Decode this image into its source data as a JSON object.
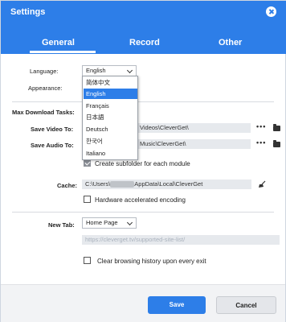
{
  "window": {
    "title": "Settings"
  },
  "tabs": [
    {
      "label": "General"
    },
    {
      "label": "Record"
    },
    {
      "label": "Other"
    }
  ],
  "general": {
    "language_label": "Language:",
    "language_value": "English",
    "appearance_label": "Appearance:",
    "max_tasks_label": "Max Download Tasks:",
    "save_video_label": "Save Video To:",
    "save_video_path": "Videos\\CleverGet\\",
    "save_audio_label": "Save Audio To:",
    "save_audio_path": "Music\\CleverGet\\",
    "subfolder_label": "Create subfolder for each module",
    "subfolder_checked": true,
    "cache_label": "Cache:",
    "cache_path_prefix": "C:\\Users\\",
    "cache_path_suffix": "AppData\\Local\\CleverGet",
    "hw_accel_label": "Hardware accelerated encoding",
    "hw_accel_checked": false,
    "new_tab_label": "New Tab:",
    "new_tab_value": "Home Page",
    "new_tab_url": "https://cleverget.tv/supported-site-list/",
    "clear_history_label": "Clear browsing history upon every exit",
    "clear_history_checked": false
  },
  "language_dropdown": {
    "options": [
      "简体中文",
      "English",
      "Français",
      "日本語",
      "Deutsch",
      "한국어",
      "Italiano"
    ],
    "selected_index": 1
  },
  "more_glyph": "•••",
  "footer": {
    "save_label": "Save",
    "cancel_label": "Cancel"
  },
  "colors": {
    "accent": "#2d7ee8",
    "field_bg": "#e6e9ed"
  }
}
